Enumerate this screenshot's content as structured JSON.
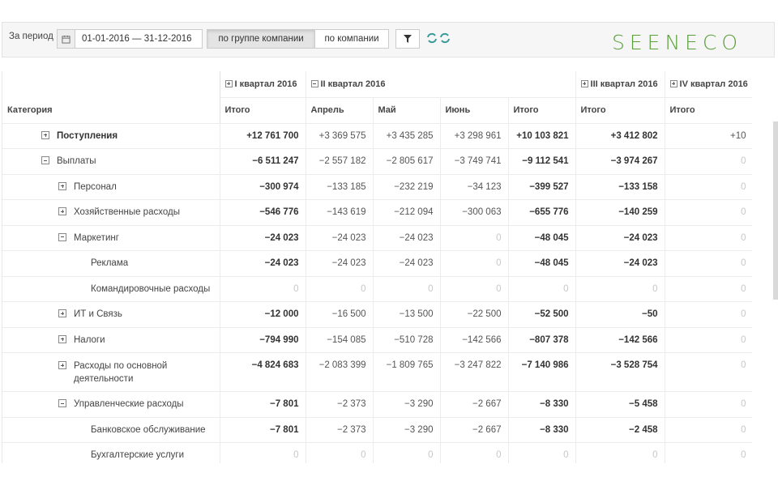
{
  "toolbar": {
    "period_label": "За период",
    "date_range": "01-01-2016 — 31-12-2016",
    "by_group": "по группе компании",
    "by_company": "по компании",
    "logo": "SEENECO"
  },
  "table": {
    "category_header": "Категория",
    "quarters": [
      {
        "label": "I квартал 2016",
        "expanded": false
      },
      {
        "label": "II квартал 2016",
        "expanded": true
      },
      {
        "label": "III квартал 2016",
        "expanded": false
      },
      {
        "label": "IV квартал 2016",
        "expanded": false
      }
    ],
    "subheaders": [
      "Итого",
      "Апрель",
      "Май",
      "Июнь",
      "Итого",
      "Итого",
      "Итого"
    ],
    "rows": [
      {
        "name": "Поступления",
        "toggle": "plus",
        "bold": true,
        "values": [
          "+12 761 700",
          "+3 369 575",
          "+3 435 285",
          "+3 298 961",
          "+10 103 821",
          "+3 412 802",
          "+10"
        ]
      },
      {
        "name": "Выплаты",
        "toggle": "minus",
        "values": [
          "−6 511 247",
          "−2 557 182",
          "−2 805 617",
          "−3 749 741",
          "−9 112 541",
          "−3 974 267",
          "0"
        ]
      },
      {
        "name": "Персонал",
        "toggle": "plus",
        "values": [
          "−300 974",
          "−133 185",
          "−232 219",
          "−34 123",
          "−399 527",
          "−133 158",
          "0"
        ]
      },
      {
        "name": "Хозяйственные расходы",
        "toggle": "plus",
        "values": [
          "−546 776",
          "−143 619",
          "−212 094",
          "−300 063",
          "−655 776",
          "−140 259",
          "0"
        ]
      },
      {
        "name": "Маркетинг",
        "toggle": "minus",
        "values": [
          "−24 023",
          "−24 023",
          "−24 023",
          "0",
          "−48 045",
          "−24 023",
          "0"
        ]
      },
      {
        "name": "Реклама",
        "values": [
          "−24 023",
          "−24 023",
          "−24 023",
          "0",
          "−48 045",
          "−24 023",
          "0"
        ]
      },
      {
        "name": "Командировочные расходы",
        "values": [
          "0",
          "0",
          "0",
          "0",
          "0",
          "0",
          "0"
        ]
      },
      {
        "name": "ИТ и Связь",
        "toggle": "plus",
        "values": [
          "−12 000",
          "−16 500",
          "−13 500",
          "−22 500",
          "−52 500",
          "−50",
          "0"
        ]
      },
      {
        "name": "Налоги",
        "toggle": "plus",
        "values": [
          "−794 990",
          "−154 085",
          "−510 728",
          "−142 566",
          "−807 378",
          "−142 566",
          "0"
        ]
      },
      {
        "name": "Расходы по основной деятельности",
        "toggle": "plus",
        "values": [
          "−4 824 683",
          "−2 083 399",
          "−1 809 765",
          "−3 247 822",
          "−7 140 986",
          "−3 528 754",
          "0"
        ]
      },
      {
        "name": "Управленческие расходы",
        "toggle": "minus",
        "values": [
          "−7 801",
          "−2 373",
          "−3 290",
          "−2 667",
          "−8 330",
          "−5 458",
          "0"
        ]
      },
      {
        "name": "Банковское обслуживание",
        "values": [
          "−7 801",
          "−2 373",
          "−3 290",
          "−2 667",
          "−8 330",
          "−2 458",
          "0"
        ]
      },
      {
        "name": "Бухгалтерские услуги",
        "values": [
          "0",
          "0",
          "0",
          "0",
          "0",
          "0",
          "0"
        ]
      }
    ]
  },
  "colors": {
    "accent": "#5a9f3a"
  }
}
